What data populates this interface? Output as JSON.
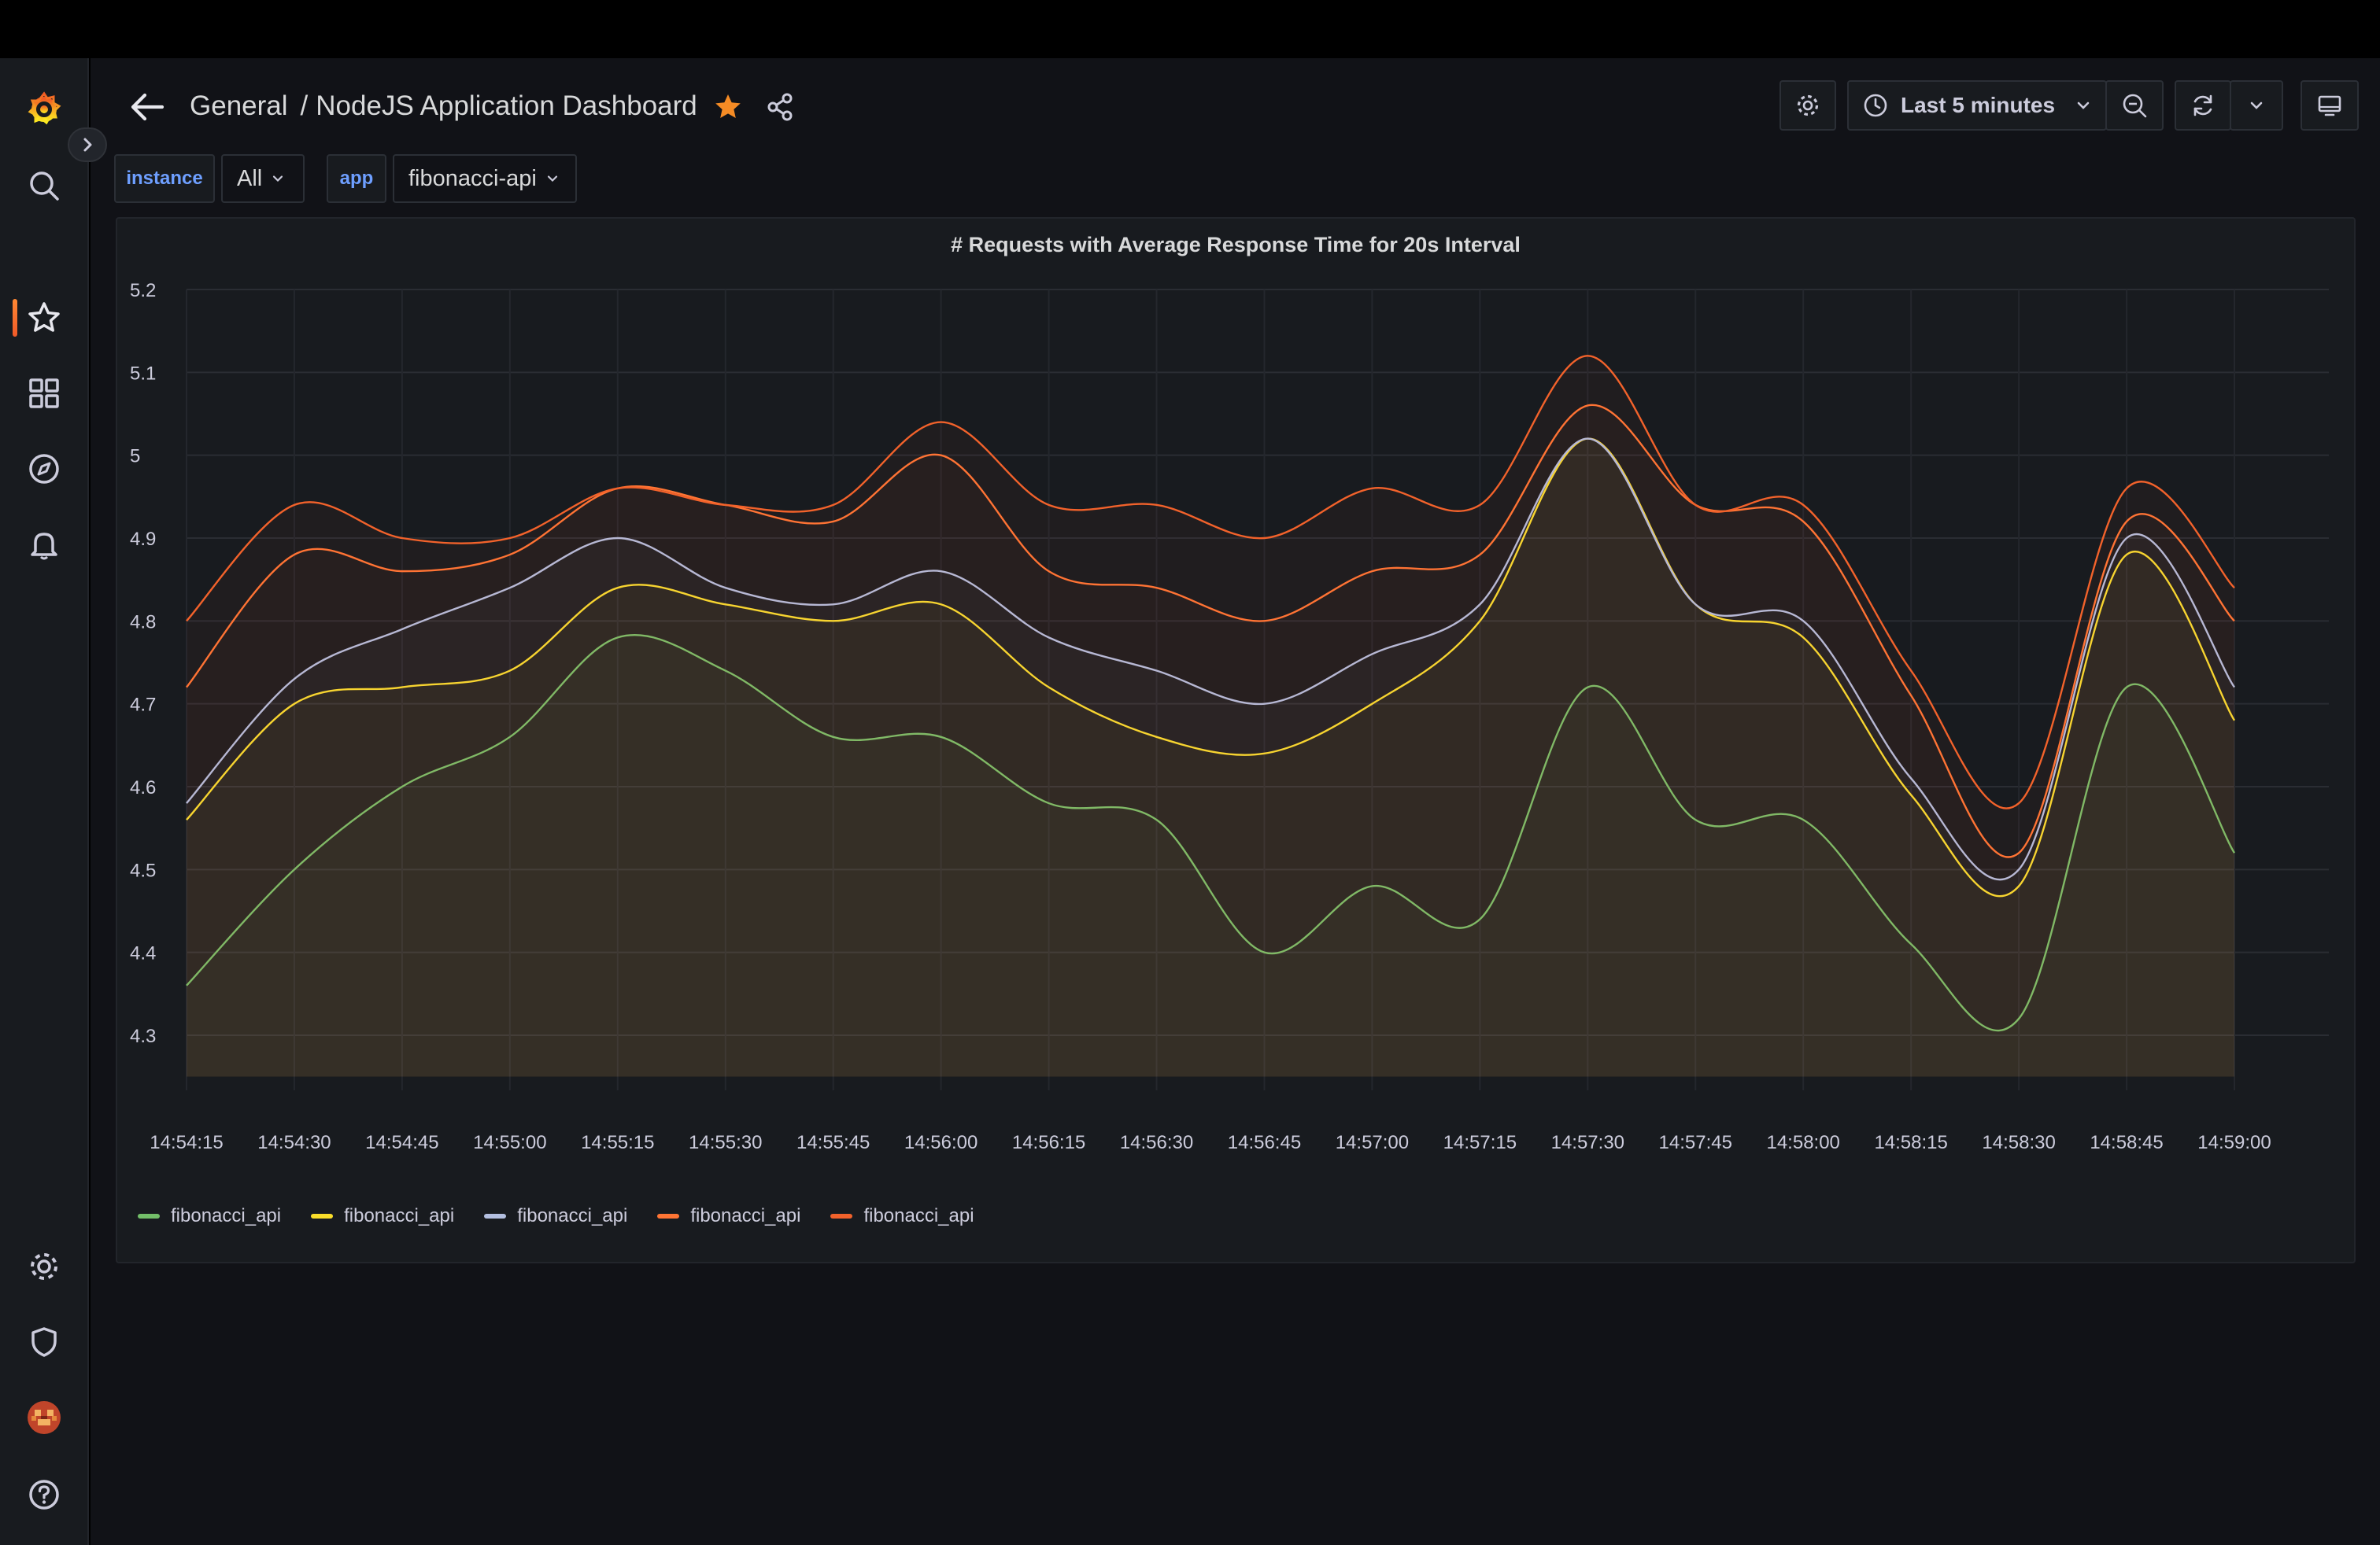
{
  "header": {
    "breadcrumb_folder": "General",
    "breadcrumb_sep": "/",
    "breadcrumb_dashboard": "NodeJS Application Dashboard",
    "time_range": "Last 5 minutes"
  },
  "variables": [
    {
      "label": "instance",
      "value": "All"
    },
    {
      "label": "app",
      "value": "fibonacci-api"
    }
  ],
  "sidebar": {
    "top_items": [
      "grafana-logo-icon",
      "search-icon",
      "star-icon",
      "dashboards-icon",
      "explore-icon",
      "alerting-icon"
    ],
    "bottom_items": [
      "configuration-icon",
      "server-admin-icon",
      "user-avatar",
      "help-icon"
    ],
    "active_item": "star-icon"
  },
  "colors": {
    "accent": "#f05a28",
    "star": "#f58b25",
    "series": [
      "#73bf69",
      "#fade2a",
      "#b3bfe0",
      "#ff7534",
      "#f2622b"
    ]
  },
  "chart_data": {
    "type": "line",
    "title": "# Requests with Average Response Time for 20s Interval",
    "xlabel": "",
    "ylabel": "",
    "ylim": [
      4.25,
      5.2
    ],
    "yticks": [
      "5.2",
      "5.1",
      "5",
      "4.9",
      "4.8",
      "4.7",
      "4.6",
      "4.5",
      "4.4",
      "4.3"
    ],
    "grid": true,
    "legend_placement": "bottom-left",
    "x": [
      "14:54:15",
      "14:54:30",
      "14:54:45",
      "14:55:00",
      "14:55:15",
      "14:55:30",
      "14:55:45",
      "14:56:00",
      "14:56:15",
      "14:56:30",
      "14:56:45",
      "14:57:00",
      "14:57:15",
      "14:57:30",
      "14:57:45",
      "14:58:00",
      "14:58:15",
      "14:58:30",
      "14:58:45",
      "14:59:00"
    ],
    "series": [
      {
        "name": "fibonacci_api",
        "color": "#73bf69",
        "values": [
          4.36,
          4.5,
          4.6,
          4.66,
          4.78,
          4.74,
          4.66,
          4.66,
          4.58,
          4.56,
          4.4,
          4.48,
          4.44,
          4.72,
          4.56,
          4.56,
          4.41,
          4.32,
          4.72,
          4.52
        ]
      },
      {
        "name": "fibonacci_api",
        "color": "#fade2a",
        "values": [
          4.56,
          4.7,
          4.72,
          4.74,
          4.84,
          4.82,
          4.8,
          4.82,
          4.72,
          4.66,
          4.64,
          4.7,
          4.8,
          5.02,
          4.82,
          4.78,
          4.59,
          4.48,
          4.88,
          4.68
        ]
      },
      {
        "name": "fibonacci_api",
        "color": "#b3bfe0",
        "values": [
          4.58,
          4.73,
          4.79,
          4.84,
          4.9,
          4.84,
          4.82,
          4.86,
          4.78,
          4.74,
          4.7,
          4.76,
          4.82,
          5.02,
          4.82,
          4.8,
          4.61,
          4.5,
          4.9,
          4.72
        ]
      },
      {
        "name": "fibonacci_api",
        "color": "#ff7534",
        "values": [
          4.72,
          4.88,
          4.86,
          4.88,
          4.96,
          4.94,
          4.92,
          5.0,
          4.86,
          4.84,
          4.8,
          4.86,
          4.88,
          5.06,
          4.94,
          4.92,
          4.71,
          4.52,
          4.92,
          4.8
        ]
      },
      {
        "name": "fibonacci_api",
        "color": "#f2622b",
        "values": [
          4.8,
          4.94,
          4.9,
          4.9,
          4.96,
          4.94,
          4.94,
          5.04,
          4.94,
          4.94,
          4.9,
          4.96,
          4.94,
          5.12,
          4.94,
          4.94,
          4.74,
          4.58,
          4.96,
          4.84
        ]
      }
    ]
  }
}
